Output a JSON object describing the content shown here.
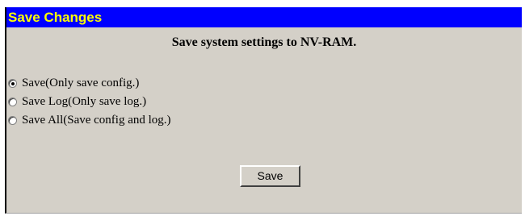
{
  "header": {
    "title": "Save Changes"
  },
  "subtitle": "Save system settings to NV-RAM.",
  "options": [
    {
      "label": "Save(Only save config.)",
      "checked": true
    },
    {
      "label": "Save Log(Only save log.)",
      "checked": false
    },
    {
      "label": "Save All(Save config and log.)",
      "checked": false
    }
  ],
  "save_button": {
    "label": "Save"
  },
  "colors": {
    "header_bg": "#0000ff",
    "header_text": "#ffff00",
    "panel_bg": "#d4d0c8"
  }
}
